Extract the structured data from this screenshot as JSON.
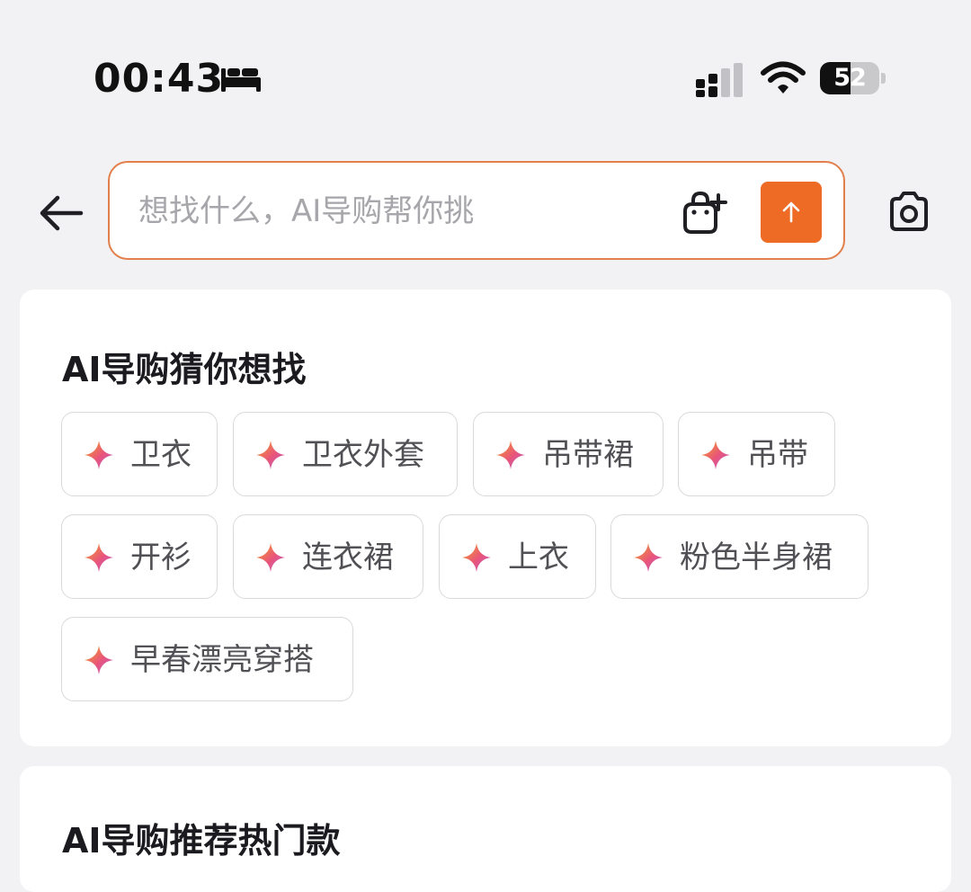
{
  "status_bar": {
    "time": "00:43",
    "battery_level": "52",
    "battery_fraction": 0.52,
    "icons": [
      "bed-icon",
      "cellular-signal-icon",
      "wifi-icon",
      "battery-icon"
    ]
  },
  "search": {
    "placeholder": "想找什么，AI导购帮你挑",
    "value": "",
    "icons": [
      "back-arrow-icon",
      "bag-plus-icon",
      "arrow-up-icon",
      "camera-icon"
    ],
    "accent_color": "#ee6b25",
    "border_color": "#e27f4a"
  },
  "guess_section": {
    "title": "AI导购猜你想找",
    "chips": [
      {
        "label": "卫衣"
      },
      {
        "label": "卫衣外套"
      },
      {
        "label": "吊带裙"
      },
      {
        "label": "吊带"
      },
      {
        "label": "开衫"
      },
      {
        "label": "连衣裙"
      },
      {
        "label": "上衣"
      },
      {
        "label": "粉色半身裙"
      },
      {
        "label": "早春漂亮穿搭"
      }
    ],
    "chip_icon": "sparkle-icon",
    "sparkle_colors": [
      "#f5a623",
      "#e8547a",
      "#b65fd8"
    ]
  },
  "hot_section": {
    "title": "AI导购推荐热门款"
  }
}
